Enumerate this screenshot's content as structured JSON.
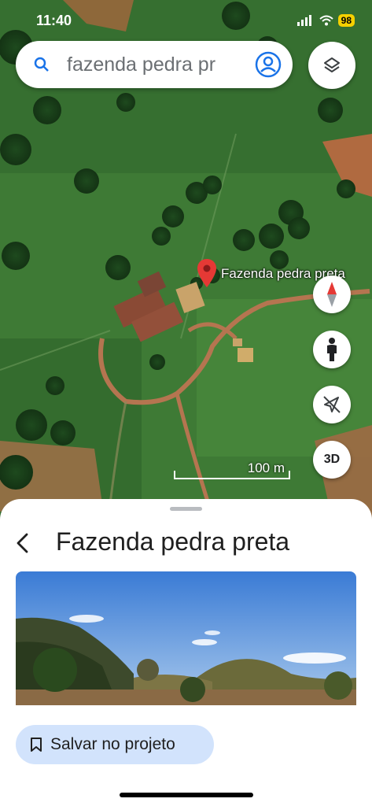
{
  "status_bar": {
    "time": "11:40",
    "battery": "98"
  },
  "search": {
    "query": "fazenda pedra pr",
    "icon": "search-icon"
  },
  "map": {
    "pin_label": "Fazenda pedra preta",
    "scale_label": "100 m",
    "three_d_label": "3D"
  },
  "place": {
    "name": "Fazenda pedra preta",
    "save_label": "Salvar no projeto"
  },
  "colors": {
    "accent": "#1a73e8",
    "pin": "#e53935",
    "button_bg": "#d2e3fc"
  }
}
